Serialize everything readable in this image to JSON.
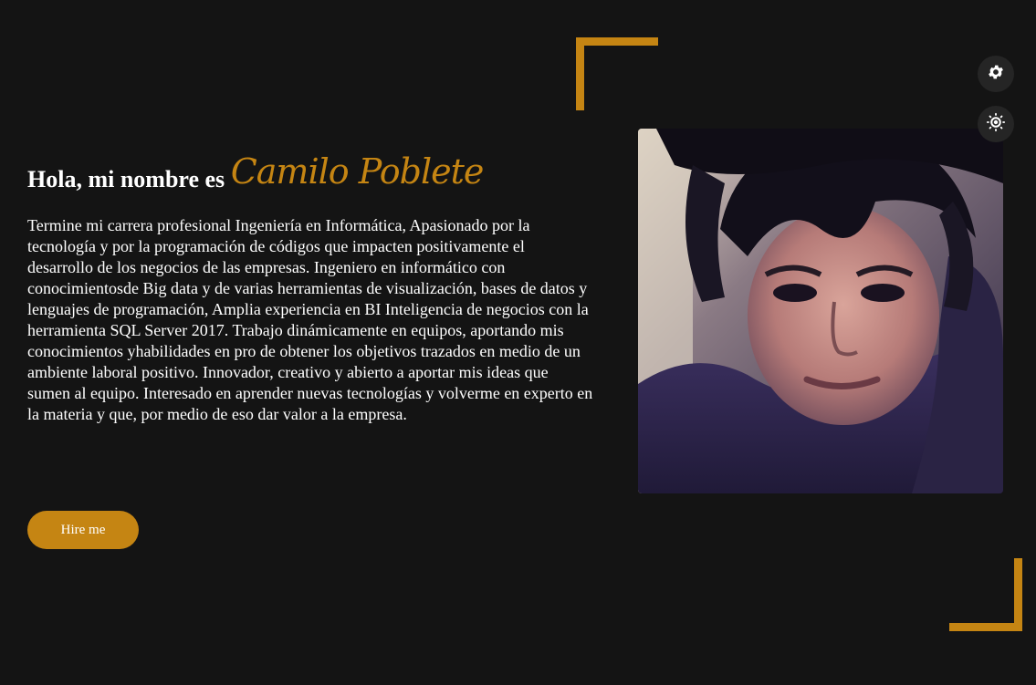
{
  "hero": {
    "greeting": "Hola, mi nombre es",
    "name": "Camilo Poblete",
    "bio": "Termine mi carrera profesional Ingeniería en Informática, Apasionado por la tecnología y por la programación de códigos que impacten positivamente el desarrollo de los negocios de las empresas. Ingeniero en informático con conocimientosde Big data y de varias herramientas de visualización, bases de datos y lenguajes de programación, Amplia experiencia en BI Inteligencia de negocios con la herramienta SQL Server 2017. Trabajo dinámicamente en equipos, aportando mis conocimientos yhabilidades en pro de obtener los objetivos trazados en medio de un ambiente laboral positivo. Innovador, creativo y abierto a aportar mis ideas que sumen al equipo. Interesado en aprender nuevas tecnologías y volverme en experto en la materia y que, por medio de eso dar valor a la empresa.",
    "hire_label": "Hire me"
  },
  "controls": {
    "settings_icon": "gear-icon",
    "theme_icon": "sun-icon"
  },
  "colors": {
    "background": "#141414",
    "accent": "#c58513",
    "text": "#ffffff",
    "icon_button_bg": "#252525"
  }
}
